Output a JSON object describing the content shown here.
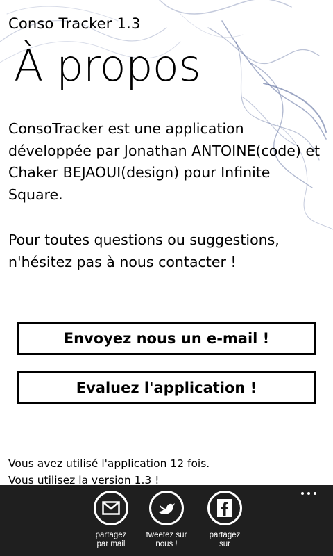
{
  "app": {
    "title": "Conso Tracker 1.3"
  },
  "page": {
    "title": "À propos"
  },
  "content": {
    "description": "ConsoTracker est une application développée par Jonathan ANTOINE(code) et Chaker BEJAOUI(design) pour Infinite Square.",
    "contact": "Pour toutes questions ou suggestions, n'hésitez pas à nous contacter !"
  },
  "buttons": {
    "email": "Envoyez nous un e-mail !",
    "rate": "Evaluez l'application !"
  },
  "usage": {
    "count_text": "Vous avez utilisé l'application 12 fois.",
    "version_text": "Vous utilisez la version 1.3 !"
  },
  "appbar": {
    "buttons": [
      {
        "label": "partagez\npar mail",
        "icon": "mail-icon"
      },
      {
        "label": "tweetez sur\nnous !",
        "icon": "twitter-bird-icon"
      },
      {
        "label": "partagez\nsur",
        "icon": "facebook-icon"
      }
    ],
    "more": "ellipsis-icon"
  },
  "colors": {
    "background": "#ffffff",
    "appbar": "#1f1f1f",
    "smoke": "#3c4f8a"
  }
}
